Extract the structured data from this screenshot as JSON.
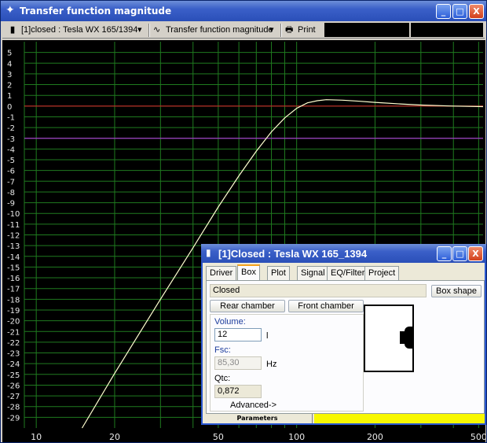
{
  "window": {
    "title": "Transfer function magnitude",
    "buttons": {
      "minimize": "_",
      "maximize": "□",
      "close": "X"
    }
  },
  "toolbar": {
    "driver_select": "[1]closed : Tesla WX 165/1394",
    "view_select": "Transfer function magnitude",
    "print_label": "Print"
  },
  "chart_data": {
    "type": "line",
    "title": "",
    "xlabel": "",
    "ylabel": "",
    "xscale": "log",
    "xlim": [
      9,
      520
    ],
    "ylim": [
      -30,
      6
    ],
    "x_ticks": [
      "10",
      "20",
      "50",
      "100",
      "200",
      "500"
    ],
    "y_ticks": [
      "5",
      "4",
      "3",
      "2",
      "1",
      "0",
      "-1",
      "-2",
      "-3",
      "-4",
      "-5",
      "-6",
      "-7",
      "-8",
      "-9",
      "-10",
      "-11",
      "-12",
      "-13",
      "-14",
      "-15",
      "-16",
      "-17",
      "-18",
      "-19",
      "-20",
      "-21",
      "-22",
      "-23",
      "-24",
      "-25",
      "-26",
      "-27",
      "-28",
      "-29"
    ],
    "grid": true,
    "reference_lines": [
      {
        "y": 0,
        "color": "#c82828"
      },
      {
        "y": -3,
        "color": "#a03cc8"
      }
    ],
    "series": [
      {
        "color": "#ffffd0",
        "x": [
          15,
          20,
          25,
          30,
          40,
          50,
          60,
          70,
          80,
          90,
          100,
          110,
          120,
          130,
          150,
          175,
          200,
          250,
          300,
          400,
          520
        ],
        "y": [
          -30,
          -24.9,
          -21.1,
          -18.0,
          -13.2,
          -9.4,
          -6.5,
          -4.2,
          -2.4,
          -1.1,
          -0.2,
          0.3,
          0.5,
          0.6,
          0.55,
          0.45,
          0.35,
          0.2,
          0.1,
          0.0,
          -0.05
        ]
      }
    ]
  },
  "dialog": {
    "title": "[1]Closed : Tesla WX 165_1394",
    "tabs": [
      "Driver",
      "Box",
      "Plot",
      "Signal",
      "EQ/Filter",
      "Project"
    ],
    "active_tab": "Box",
    "box_type": "Closed",
    "box_shape_button": "Box shape",
    "rear_chamber_button": "Rear chamber",
    "front_chamber_button": "Front chamber",
    "volume_label": "Volume:",
    "volume_value": "12",
    "volume_unit": "l",
    "fsc_label": "Fsc:",
    "fsc_value": "85,30",
    "fsc_unit": "Hz",
    "qtc_label": "Qtc:",
    "qtc_value": "0,872",
    "advanced_label": "Advanced->",
    "status_label": "Parameters",
    "colors": {
      "status_bar": "#f8f800",
      "accent_label": "#1c3c9c"
    }
  }
}
